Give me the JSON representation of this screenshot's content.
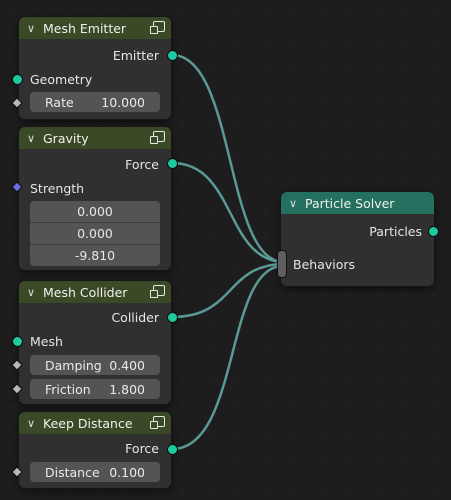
{
  "nodes": {
    "mesh_emitter": {
      "title": "Mesh Emitter",
      "output": "Emitter",
      "input": "Geometry",
      "field": {
        "label": "Rate",
        "value": "10.000"
      }
    },
    "gravity": {
      "title": "Gravity",
      "output": "Force",
      "input": "Strength",
      "vector": [
        "0.000",
        "0.000",
        "-9.810"
      ]
    },
    "mesh_collider": {
      "title": "Mesh Collider",
      "output": "Collider",
      "input": "Mesh",
      "fields": [
        {
          "label": "Damping",
          "value": "0.400"
        },
        {
          "label": "Friction",
          "value": "1.800"
        }
      ]
    },
    "keep_distance": {
      "title": "Keep Distance",
      "output": "Force",
      "field": {
        "label": "Distance",
        "value": "0.100"
      }
    },
    "particle_solver": {
      "title": "Particle Solver",
      "output": "Particles",
      "input": "Behaviors"
    }
  },
  "icons": {
    "collapse": "chevron-down-icon",
    "preview": "node-preview-icon"
  },
  "colors": {
    "socket_geometry": "#1fc9a0",
    "socket_vector": "#6b6fe3",
    "socket_float": "#b8b8b8",
    "link": "#5a9a95",
    "header_green": "#3b4a26",
    "header_teal": "#23705e"
  }
}
